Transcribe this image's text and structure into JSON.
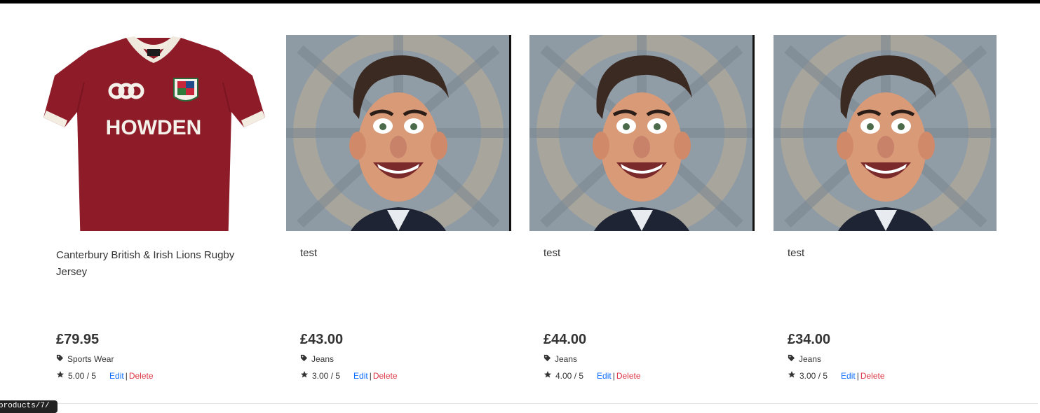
{
  "products": [
    {
      "title": "Canterbury British & Irish Lions Rugby Jersey",
      "price": "£79.95",
      "category": "Sports Wear",
      "rating": "5.00 / 5",
      "image": "rugby-jersey",
      "shirt_text": "HOWDEN"
    },
    {
      "title": "test",
      "price": "£43.00",
      "category": "Jeans",
      "rating": "3.00 / 5",
      "image": "caricature"
    },
    {
      "title": "test",
      "price": "£44.00",
      "category": "Jeans",
      "rating": "4.00 / 5",
      "image": "caricature"
    },
    {
      "title": "test",
      "price": "£34.00",
      "category": "Jeans",
      "rating": "3.00 / 5",
      "image": "caricature"
    }
  ],
  "actions": {
    "edit": "Edit",
    "separator": "|",
    "delete": "Delete"
  },
  "status_tooltip": "products/7/",
  "icons": {
    "category": "tag-icon",
    "rating": "star-icon"
  },
  "colors": {
    "edit_link": "#0d6efd",
    "delete_link": "#dc3545",
    "jersey_red": "#8e1b28"
  }
}
